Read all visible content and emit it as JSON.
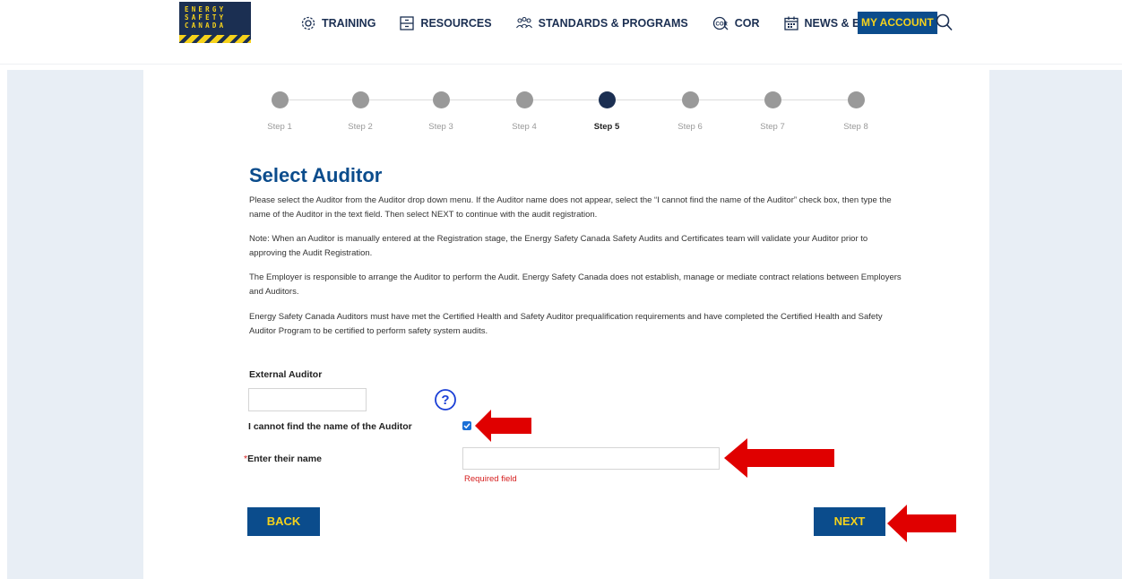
{
  "header": {
    "logo_lines": [
      "ENERGY",
      "SAFETY",
      "CANADA"
    ],
    "nav": [
      {
        "label": "TRAINING",
        "icon": "gear-icon"
      },
      {
        "label": "RESOURCES",
        "icon": "cabinet-icon"
      },
      {
        "label": "STANDARDS & PROGRAMS",
        "icon": "people-icon"
      },
      {
        "label": "COR",
        "icon": "cor-badge-icon"
      },
      {
        "label": "NEWS & EVENTS",
        "icon": "calendar-icon"
      }
    ],
    "my_account": "MY ACCOUNT",
    "search_icon": "search-icon"
  },
  "steps": {
    "items": [
      "Step 1",
      "Step 2",
      "Step 3",
      "Step 4",
      "Step 5",
      "Step 6",
      "Step 7",
      "Step 8"
    ],
    "active": "Step 5"
  },
  "content": {
    "title": "Select Auditor",
    "paragraphs": [
      "Please select the Auditor from the Auditor drop down menu. If the Auditor name does not appear, select the “I cannot find the name of the Auditor” check box, then type the name of the Auditor in the text field. Then select NEXT to continue with the audit registration.",
      "Note: When an Auditor is manually entered at the Registration stage, the Energy Safety Canada Safety Audits and Certificates team will validate your Auditor prior to approving the Audit Registration.",
      "The Employer is responsible to arrange the Auditor to perform the Audit. Energy Safety Canada does not establish, manage or mediate contract relations between Employers and Auditors.",
      "Energy Safety Canada Auditors must have met the Certified Health and Safety Auditor prequalification requirements and have completed the Certified Health and Safety Auditor Program to be certified to perform safety system audits."
    ]
  },
  "form": {
    "external_auditor_label": "External Auditor",
    "external_auditor_value": "",
    "help_icon": "help-circle-icon",
    "cannot_find_label": "I cannot find the name of the Auditor",
    "cannot_find_checked": true,
    "required_marker": "*",
    "enter_name_label": "Enter their name",
    "enter_name_value": "",
    "required_message": "Required field"
  },
  "buttons": {
    "back": "BACK",
    "next": "NEXT"
  },
  "annotations": {
    "arrow_color": "#e00000",
    "arrow_icon": "red-arrow-icon"
  },
  "colors": {
    "brand_navy": "#1b2f52",
    "button_blue": "#0b4c8c",
    "accent_yellow": "#f6d21b",
    "error_red": "#d62020"
  }
}
